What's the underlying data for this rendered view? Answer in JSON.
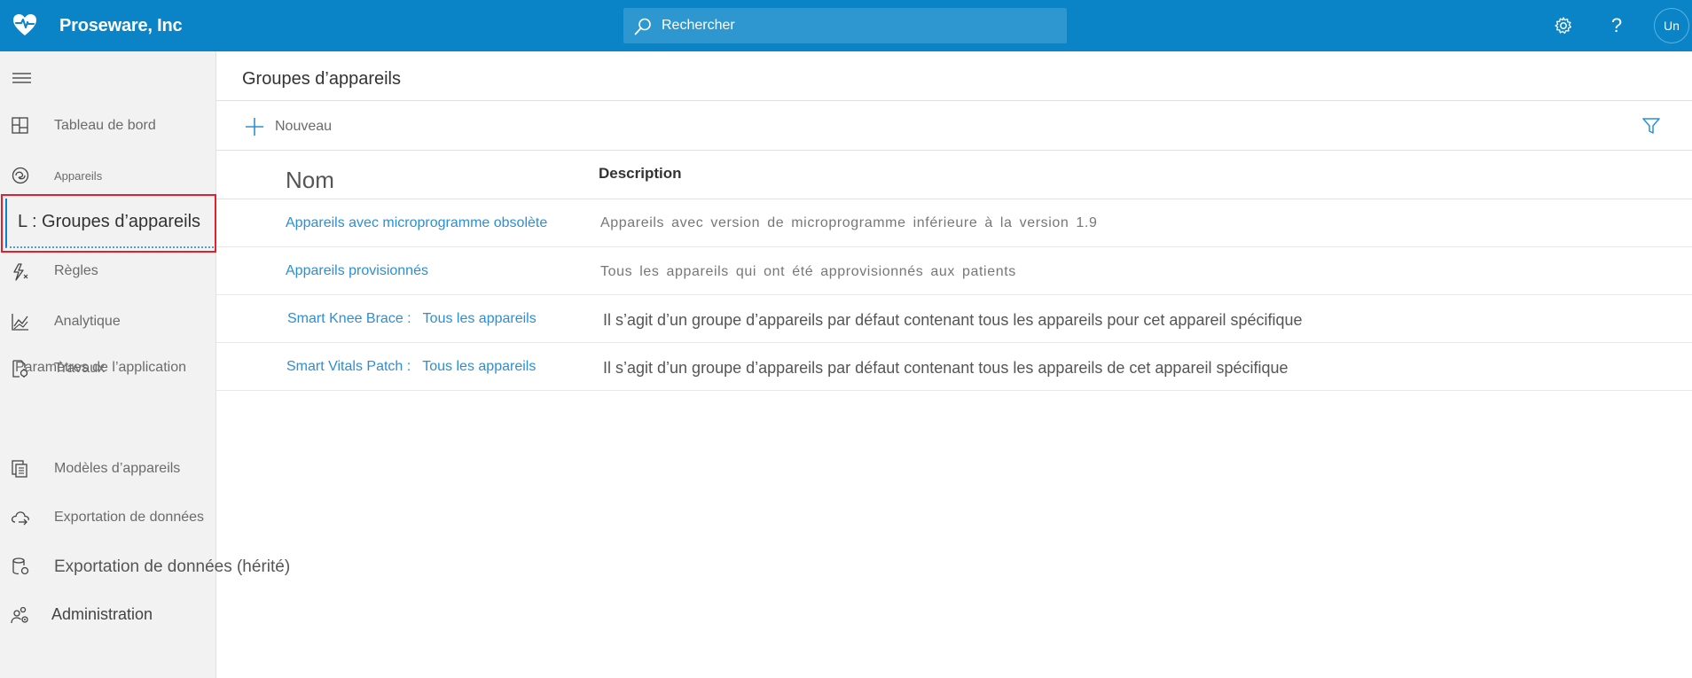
{
  "header": {
    "brand": "Proseware, Inc",
    "search_placeholder": "Rechercher",
    "avatar_initials": "Un",
    "help_glyph": "?",
    "colors": {
      "bar": "#0a84c6",
      "search": "#2e97cf"
    }
  },
  "sidebar": {
    "items": [
      {
        "label": "Tableau de bord",
        "icon": "dashboard-icon"
      },
      {
        "label": "Appareils",
        "icon": "devices-icon"
      },
      {
        "label": "L : Groupes d’appareils",
        "icon": "device-groups-icon",
        "selected": true
      },
      {
        "label": "Règles",
        "icon": "rules-icon"
      },
      {
        "label": "Analytique",
        "icon": "analytics-icon"
      },
      {
        "label": "Travaux",
        "icon": "jobs-icon"
      }
    ],
    "section_label": "Paramètres de l’application",
    "settings_items": [
      {
        "label": "Modèles d’appareils",
        "icon": "device-templates-icon"
      },
      {
        "label": "Exportation de données",
        "icon": "data-export-icon"
      },
      {
        "label": "Exportation de données (hérité)",
        "icon": "legacy-data-export-icon"
      },
      {
        "label": "Administration",
        "icon": "administration-icon"
      }
    ],
    "colors": {
      "selected_border": "#e5202e"
    }
  },
  "main": {
    "title": "Groupes d’appareils",
    "new_label": "Nouveau",
    "columns": {
      "name": "Nom",
      "description": "Description"
    },
    "rows": [
      {
        "name": "Appareils avec microprogramme obsolète",
        "description": "Appareils avec version de microprogramme inférieure à la version 1.9"
      },
      {
        "name": "Appareils provisionnés",
        "description": "Tous les appareils qui ont été approvisionnés aux patients"
      },
      {
        "name": "Smart Knee Brace :   Tous les appareils",
        "description": "Il s’agit d’un groupe d’appareils par défaut contenant tous les appareils pour cet appareil spécifique"
      },
      {
        "name": "Smart Vitals Patch :   Tous les appareils",
        "description": "Il s’agit d’un groupe d’appareils par défaut contenant tous les appareils de cet appareil spécifique"
      }
    ],
    "colors": {
      "link": "#2b8fd6"
    }
  }
}
